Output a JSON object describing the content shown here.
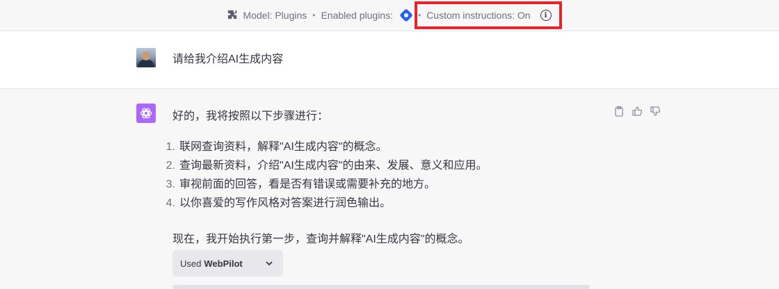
{
  "topbar": {
    "model_label": "Model: Plugins",
    "separator": "•",
    "enabled_plugins_label": "Enabled plugins:",
    "custom_instructions_label": "Custom instructions: On",
    "info_glyph": "i",
    "highlight_color": "#e8232b",
    "icons": [
      "plugin-puzzle-icon",
      "webpilot-plugin-icon",
      "info-icon"
    ]
  },
  "user_message": {
    "text": "请给我介绍AI生成内容"
  },
  "assistant_message": {
    "intro": "好的，我将按照以下步骤进行：",
    "steps": [
      {
        "num": "1.",
        "text": "联网查询资料，解释\"AI生成内容\"的概念。"
      },
      {
        "num": "2.",
        "text": "查询最新资料，介绍\"AI生成内容\"的由来、发展、意义和应用。"
      },
      {
        "num": "3.",
        "text": "审视前面的回答，看是否有错误或需要补充的地方。"
      },
      {
        "num": "4.",
        "text": "以你喜爱的写作风格对答案进行润色输出。"
      }
    ],
    "now_text": "现在，我开始执行第一步，查询并解释\"AI生成内容\"的概念。",
    "plugin_used": {
      "prefix": "Used",
      "name": "WebPilot"
    },
    "actions": [
      "clipboard-icon",
      "thumbs-up-icon",
      "thumbs-down-icon"
    ],
    "avatar_color": "#ab68ff"
  }
}
